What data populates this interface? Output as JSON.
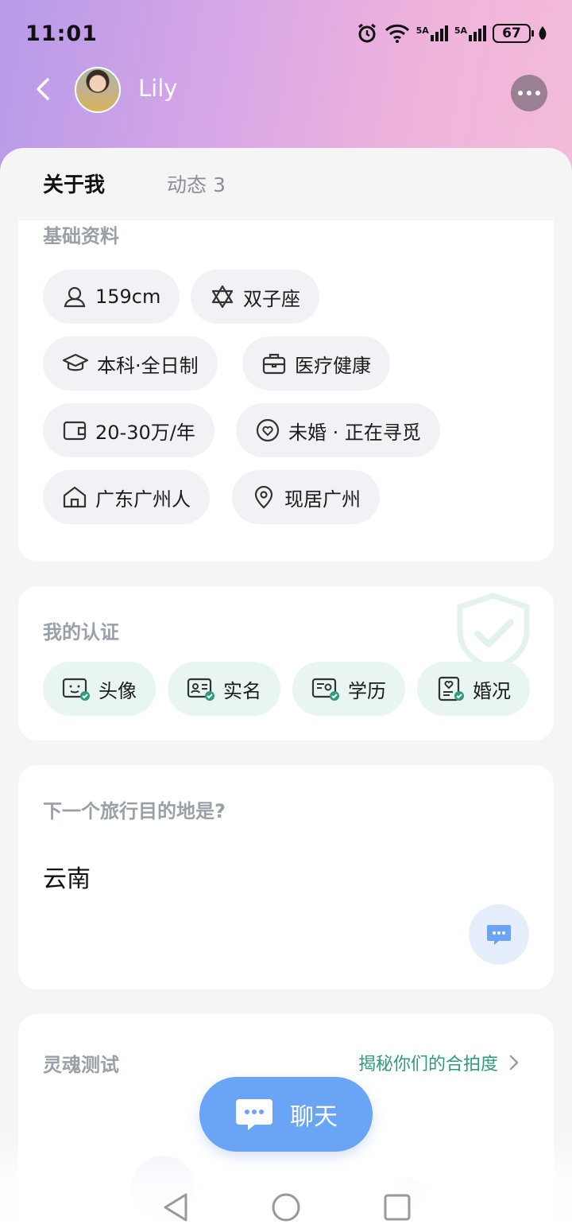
{
  "status_bar": {
    "time": "11:01",
    "signal1": "5A",
    "signal2": "5A",
    "battery": "67"
  },
  "header": {
    "user_name": "Lily"
  },
  "tabs": [
    {
      "label": "关于我",
      "active": true
    },
    {
      "label": "动态 3",
      "active": false
    }
  ],
  "basic_info": {
    "title": "基础资料",
    "chips": [
      {
        "icon": "person-icon",
        "label": "159cm"
      },
      {
        "icon": "star-of-david-icon",
        "label": "双子座"
      },
      {
        "icon": "graduation-cap-icon",
        "label": "本科·全日制"
      },
      {
        "icon": "briefcase-icon",
        "label": "医疗健康"
      },
      {
        "icon": "wallet-icon",
        "label": "20-30万/年"
      },
      {
        "icon": "heart-circle-icon",
        "label": "未婚 · 正在寻觅"
      },
      {
        "icon": "house-icon",
        "label": "广东广州人"
      },
      {
        "icon": "location-pin-icon",
        "label": "现居广州"
      }
    ]
  },
  "certification": {
    "title": "我的认证",
    "items": [
      {
        "icon": "face-card-icon",
        "label": "头像"
      },
      {
        "icon": "id-card-icon",
        "label": "实名"
      },
      {
        "icon": "diploma-icon",
        "label": "学历"
      },
      {
        "icon": "marriage-doc-icon",
        "label": "婚况"
      }
    ],
    "accent": "#2f9a7d"
  },
  "travel": {
    "question": "下一个旅行目的地是?",
    "answer": "云南"
  },
  "soul_test": {
    "title": "灵魂测试",
    "link": "揭秘你们的合拍度"
  },
  "chat_button": {
    "label": "聊天"
  },
  "colors": {
    "chat_blue": "#6aa4f4",
    "cert_green": "#2f9a7d"
  }
}
